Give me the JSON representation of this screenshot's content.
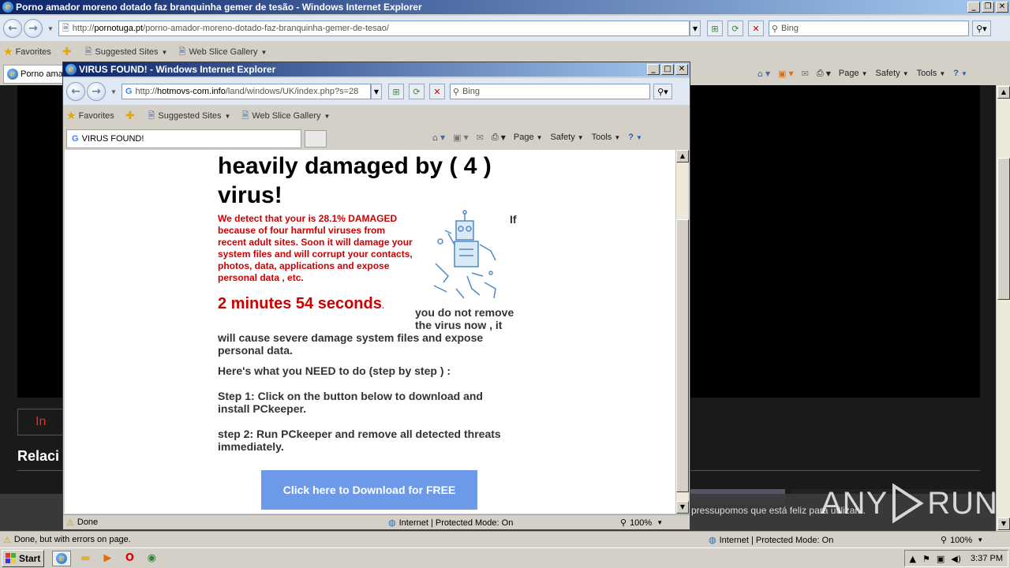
{
  "back_window": {
    "title": "Porno amador moreno dotado faz branquinha gemer de tesão - Windows Internet Explorer",
    "address_scheme": "http://",
    "address_host": "pornotuga.pt",
    "address_path": "/porno-amador-moreno-dotado-faz-branquinha-gemer-de-tesao/",
    "search_placeholder": "Bing",
    "favorites_label": "Favorites",
    "suggested_sites": "Suggested Sites",
    "web_slice": "Web Slice Gallery",
    "tab_label": "Porno ama",
    "cmd_page": "Page",
    "cmd_safety": "Safety",
    "cmd_tools": "Tools",
    "page_button_fragment": "In",
    "page_heading_fragment": "Relaci",
    "cookie_text": "pressupomos que está feliz para utilizar...",
    "status_text": "Done, but with errors on page.",
    "zone_text": "Internet | Protected Mode: On",
    "zoom": "100%"
  },
  "popup": {
    "title": "VIRUS FOUND! - Windows Internet Explorer",
    "address_scheme": "http://",
    "address_host": "hotmovs-com.info",
    "address_path": "/land/windows/UK/index.php?s=28",
    "search_placeholder": "Bing",
    "favorites_label": "Favorites",
    "suggested_sites": "Suggested Sites",
    "web_slice": "Web Slice Gallery",
    "tab_label": "VIRUS FOUND!",
    "cmd_page": "Page",
    "cmd_safety": "Safety",
    "cmd_tools": "Tools",
    "headline": "heavily damaged by ( 4 ) virus!",
    "red_warning": "We detect that your is 28.1% DAMAGED because of four harmful viruses from recent adult sites. Soon it will damage your system files and will corrupt your contacts, photos, data, applications and expose personal data , etc.",
    "if_word": "If",
    "timer": "2 minutes 54 seconds",
    "timer_dot": ".",
    "tail_1": "you do not remove the virus now , it",
    "tail_2": "will cause severe damage system files and expose personal data.",
    "need_to_do": "Here's what you NEED to do (step by step ) :",
    "step1": "Step 1: Click on the button below to download and install PCkeeper.",
    "step2": "step 2: Run PCkeeper and remove all detected threats immediately.",
    "download_button": "Click here to Download for FREE",
    "status_text": "Done",
    "zone_text": "Internet | Protected Mode: On",
    "zoom": "100%"
  },
  "taskbar": {
    "start_label": "Start",
    "clock": "3:37 PM"
  },
  "watermark": {
    "any": "ANY",
    "run": "RUN"
  },
  "colors": {
    "warning_red": "#cc0000",
    "download_button": "#6d9ae8",
    "titlebar_active": "#0a246a"
  }
}
